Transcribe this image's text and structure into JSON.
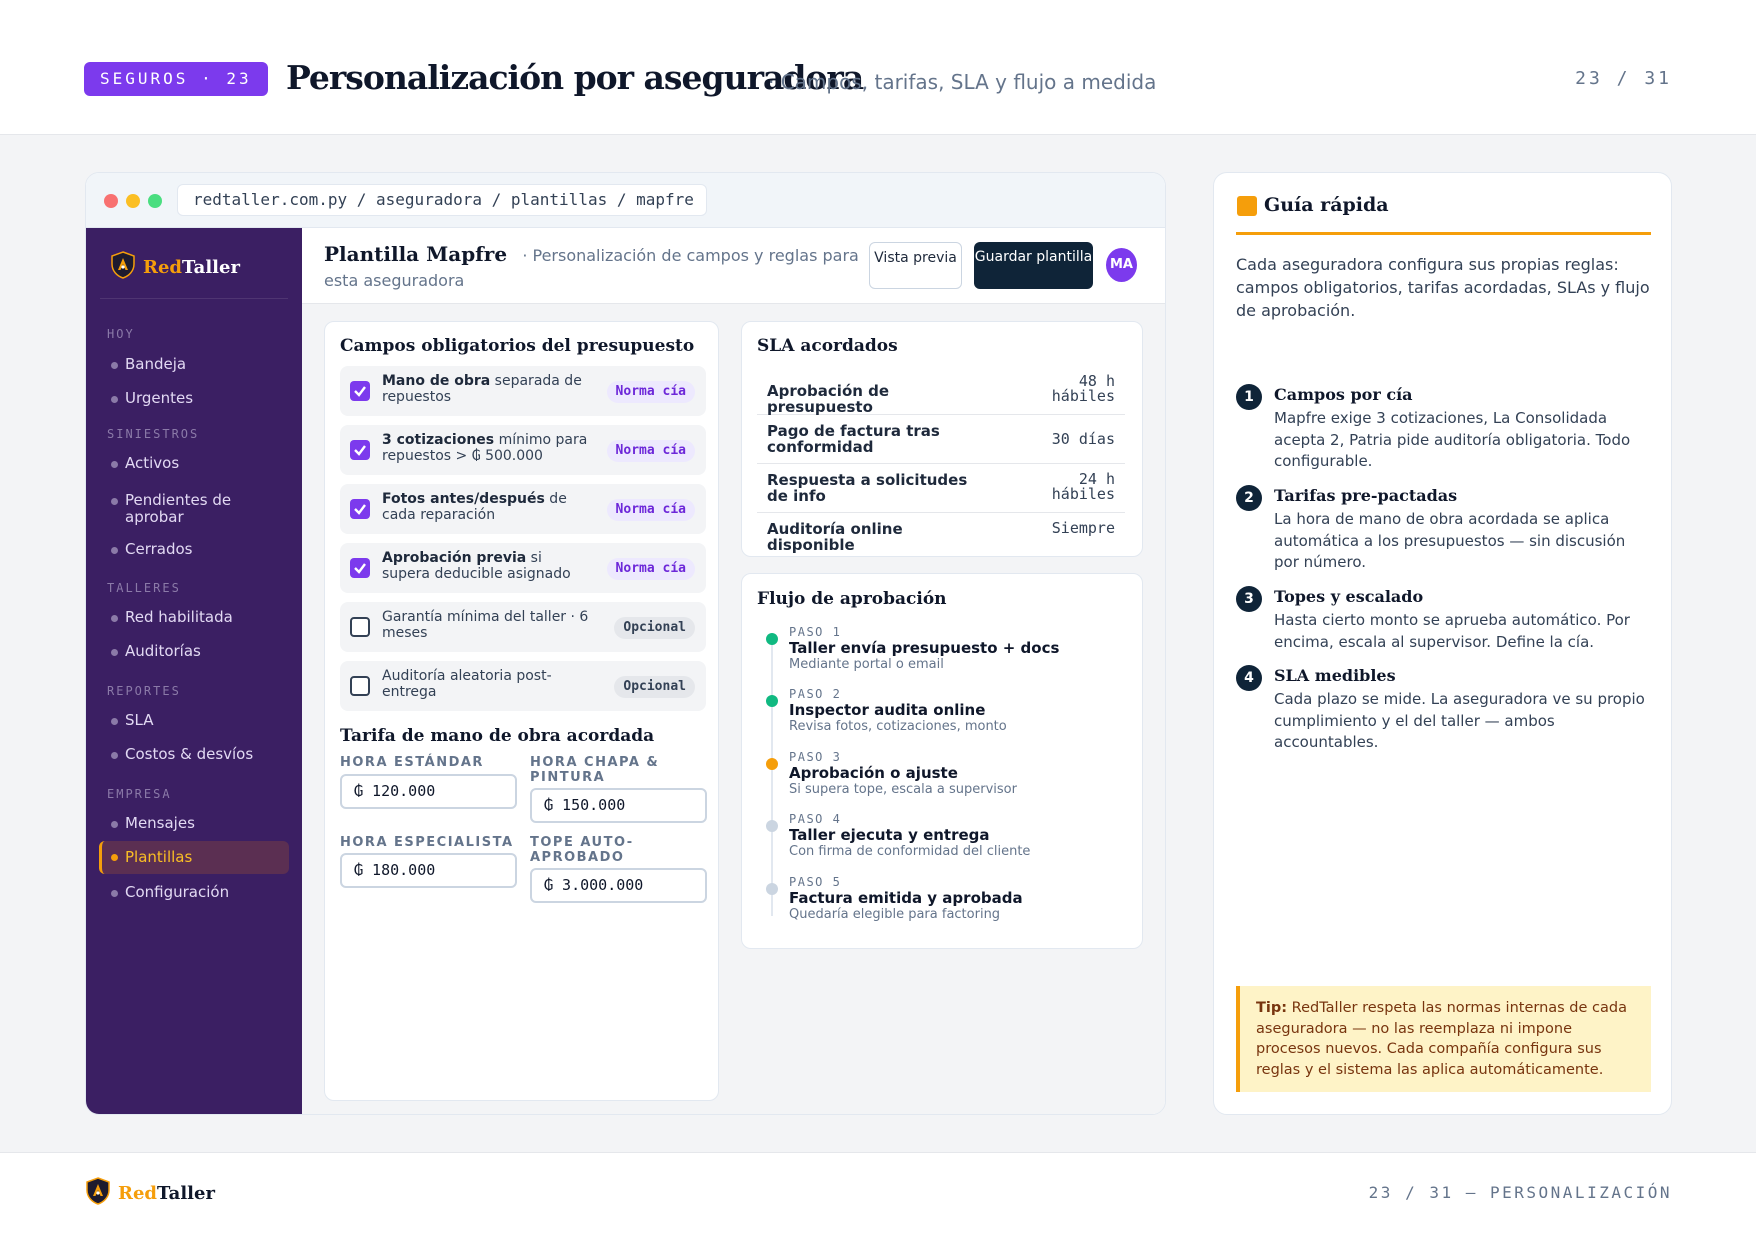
{
  "header": {
    "badge": "SEGUROS · 23",
    "title": "Personalización por aseguradora",
    "subtitle": "· Campos, tarifas, SLA y flujo a medida",
    "page": "23 / 31"
  },
  "browser": {
    "url": "redtaller.com.py / aseguradora / plantillas / mapfre"
  },
  "sidebar": {
    "brand_red": "Red",
    "brand_rest": "Taller",
    "sections": {
      "hoy": "HOY",
      "siniestros": "SINIESTROS",
      "talleres": "TALLERES",
      "reportes": "REPORTES",
      "empresa": "EMPRESA"
    },
    "items": {
      "bandeja": "Bandeja",
      "urgentes": "Urgentes",
      "activos": "Activos",
      "pendientes": "Pendientes de aprobar",
      "cerrados": "Cerrados",
      "red": "Red habilitada",
      "auditorias": "Auditorías",
      "sla": "SLA",
      "costos": "Costos & desvíos",
      "mensajes": "Mensajes",
      "plantillas": "Plantillas",
      "config": "Configuración"
    }
  },
  "main": {
    "title": "Plantilla Mapfre",
    "subtitle": "· Personalización de campos y reglas para esta aseguradora",
    "preview_btn": "Vista previa",
    "save_btn": "Guardar plantilla",
    "avatar": "MA"
  },
  "fields": {
    "title": "Campos obligatorios del presupuesto",
    "rows": [
      {
        "bold": "Mano de obra",
        "text": " separada de repuestos",
        "tag": "Norma cía",
        "checked": true
      },
      {
        "bold": "3 cotizaciones",
        "text": " mínimo para repuestos > ₲ 500.000",
        "tag": "Norma cía",
        "checked": true
      },
      {
        "bold": "Fotos antes/después",
        "text": " de cada reparación",
        "tag": "Norma cía",
        "checked": true
      },
      {
        "bold": "Aprobación previa",
        "text": " si supera deducible asignado",
        "tag": "Norma cía",
        "checked": true
      },
      {
        "bold": "",
        "text": "Garantía mínima del taller · 6 meses",
        "tag": "Opcional",
        "checked": false
      },
      {
        "bold": "",
        "text": "Auditoría aleatoria post-entrega",
        "tag": "Opcional",
        "checked": false
      }
    ]
  },
  "tarifa": {
    "title": "Tarifa de mano de obra acordada",
    "estandar_label": "HORA ESTÁNDAR",
    "estandar_value": "₲ 120.000",
    "chapa_label": "HORA CHAPA & PINTURA",
    "chapa_value": "₲ 150.000",
    "especialista_label": "HORA ESPECIALISTA",
    "especialista_value": "₲ 180.000",
    "tope_label": "TOPE AUTO-APROBADO",
    "tope_value": "₲ 3.000.000"
  },
  "sla": {
    "title": "SLA acordados",
    "rows": [
      {
        "k": "Aprobación de presupuesto",
        "v1": "48 h",
        "v2": "hábiles"
      },
      {
        "k": "Pago de factura tras conformidad",
        "v1": "30 días",
        "v2": ""
      },
      {
        "k": "Respuesta a solicitudes de info",
        "v1": "24 h",
        "v2": "hábiles"
      },
      {
        "k": "Auditoría online disponible",
        "v1": "Siempre",
        "v2": ""
      }
    ]
  },
  "flujo": {
    "title": "Flujo de aprobación",
    "steps": [
      {
        "step": "PASO 1",
        "title": "Taller envía presupuesto + docs",
        "desc": "Mediante portal o email",
        "color": "#10b981"
      },
      {
        "step": "PASO 2",
        "title": "Inspector audita online",
        "desc": "Revisa fotos, cotizaciones, monto",
        "color": "#10b981"
      },
      {
        "step": "PASO 3",
        "title": "Aprobación o ajuste",
        "desc": "Si supera tope, escala a supervisor",
        "color": "#f59e0b"
      },
      {
        "step": "PASO 4",
        "title": "Taller ejecuta y entrega",
        "desc": "Con firma de conformidad del cliente",
        "color": "#cbd5e1"
      },
      {
        "step": "PASO 5",
        "title": "Factura emitida y aprobada",
        "desc": "Quedaría elegible para factoring",
        "color": "#cbd5e1"
      }
    ]
  },
  "guide": {
    "title": "Guía rápida",
    "intro": "Cada aseguradora configura sus propias reglas: campos obligatorios, tarifas acordadas, SLAs y flujo de aprobación.",
    "items": [
      {
        "n": "1",
        "h": "Campos por cía",
        "d": "Mapfre exige 3 cotizaciones, La Consolidada acepta 2, Patria pide auditoría obligatoria. Todo configurable."
      },
      {
        "n": "2",
        "h": "Tarifas pre-pactadas",
        "d": "La hora de mano de obra acordada se aplica automática a los presupuestos — sin discusión por número."
      },
      {
        "n": "3",
        "h": "Topes y escalado",
        "d": "Hasta cierto monto se aprueba automático. Por encima, escala al supervisor. Define la cía."
      },
      {
        "n": "4",
        "h": "SLA medibles",
        "d": "Cada plazo se mide. La aseguradora ve su propio cumplimiento y el del taller — ambos accountables."
      }
    ],
    "tip_label": "Tip:",
    "tip_text": " RedTaller respeta las normas internas de cada aseguradora — no las reemplaza ni impone procesos nuevos. Cada compañía configura sus reglas y el sistema las aplica automáticamente."
  },
  "footer": {
    "brand_red": "Red",
    "brand_rest": "Taller",
    "right": "23 / 31 — PERSONALIZACIÓN"
  },
  "colors": {
    "accent": "#7c3aed",
    "brand_orange": "#f59e0b",
    "sidebar_bg": "#3b1f63",
    "dark_button": "#0f2438"
  },
  "icons": {
    "logo": "shield-logo-icon",
    "checkbox": "checkbox-icon"
  }
}
